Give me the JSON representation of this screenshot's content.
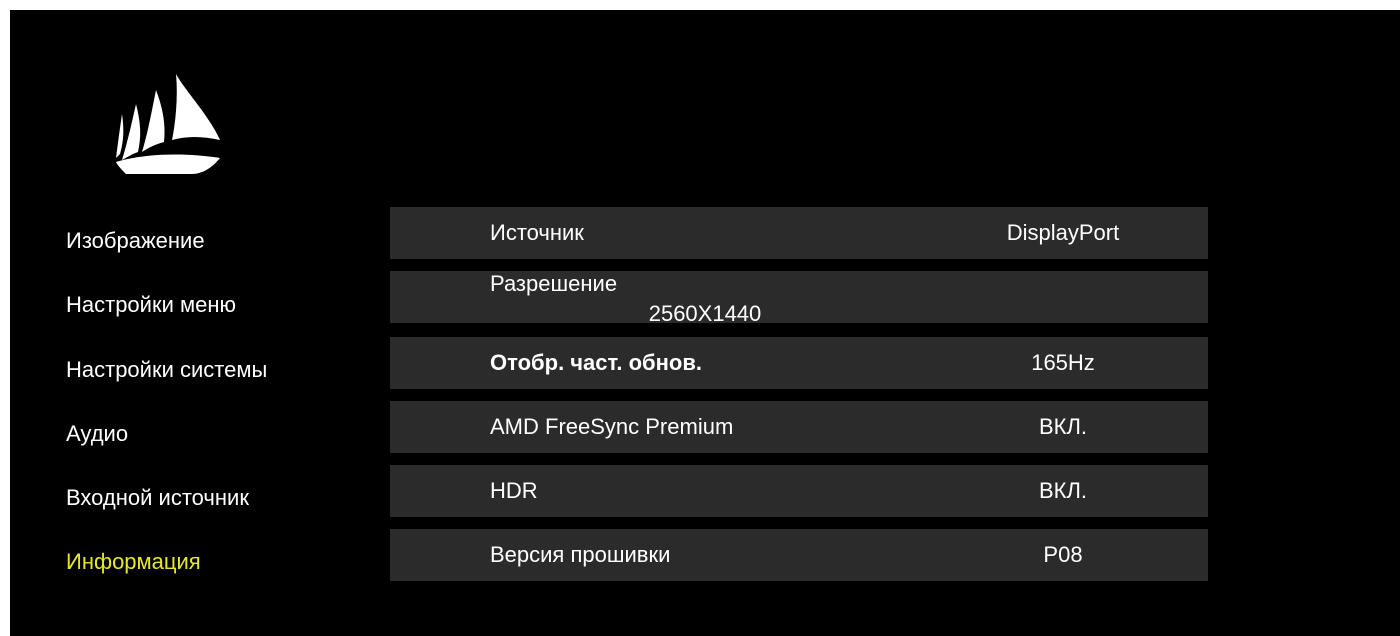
{
  "brand": {
    "logo_icon": "corsair-sails-logo-icon"
  },
  "colors": {
    "background": "#000000",
    "row_background": "#2b2b2b",
    "text": "#ffffff",
    "active": "#e8e82a"
  },
  "menu": [
    {
      "label": "Изображение",
      "active": false
    },
    {
      "label": "Настройки меню",
      "active": false
    },
    {
      "label": "Настройки системы",
      "active": false
    },
    {
      "label": "Аудио",
      "active": false
    },
    {
      "label": "Входной источник",
      "active": false
    },
    {
      "label": "Информация",
      "active": true
    }
  ],
  "info": {
    "rows": [
      {
        "label": "Источник",
        "value": "DisplayPort"
      },
      {
        "label": "Разрешение",
        "value": "2560X1440"
      },
      {
        "label": "Отобр. част. обнов.",
        "value": "165Hz"
      },
      {
        "label": "AMD FreeSync Premium",
        "value": "ВКЛ."
      },
      {
        "label": "HDR",
        "value": "ВКЛ."
      },
      {
        "label": "Версия прошивки",
        "value": "P08"
      }
    ]
  }
}
